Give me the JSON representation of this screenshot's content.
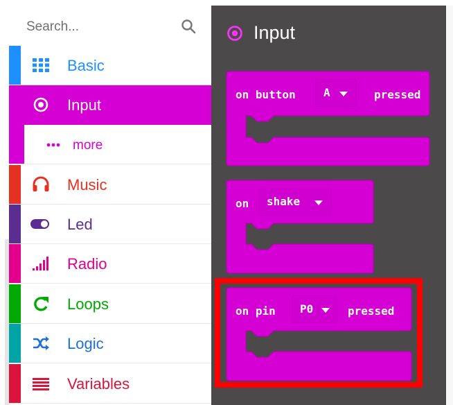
{
  "search": {
    "placeholder": "Search...",
    "icon": "search-icon"
  },
  "categories": [
    {
      "label": "Basic",
      "color": "#1e90ff",
      "icon": "grid-icon"
    },
    {
      "label": "Input",
      "color": "#d400d4",
      "icon": "target-icon",
      "selected": true
    },
    {
      "label": "more",
      "color": "#d400d4",
      "icon": "dots-icon"
    },
    {
      "label": "Music",
      "color": "#e63022",
      "icon": "headphones-icon"
    },
    {
      "label": "Led",
      "color": "#5c2d91",
      "icon": "toggle-icon"
    },
    {
      "label": "Radio",
      "color": "#e3008c",
      "icon": "signal-bars-icon"
    },
    {
      "label": "Loops",
      "color": "#00aa00",
      "icon": "loop-arrow-icon"
    },
    {
      "label": "Logic",
      "color": "#00a4a6",
      "icon": "shuffle-icon"
    },
    {
      "label": "Variables",
      "color": "#dc143c",
      "icon": "lines-icon"
    }
  ],
  "flyout": {
    "title": "Input",
    "blocks": [
      {
        "text": "on button",
        "dropdown": "A",
        "suffix": "pressed"
      },
      {
        "text": "on",
        "dropdown": "shake",
        "suffix": ""
      },
      {
        "text": "on pin",
        "dropdown": "P0",
        "suffix": "pressed",
        "highlighted": true
      }
    ]
  },
  "colors": {
    "input": "#d400d4",
    "highlight": "#ff0000",
    "flyout_bg": "#4b4949"
  }
}
